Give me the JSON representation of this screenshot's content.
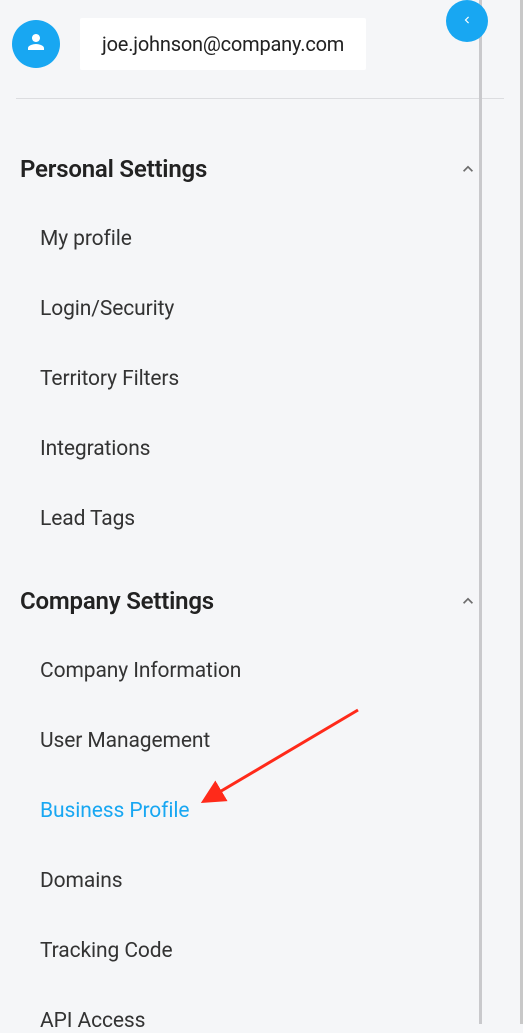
{
  "header": {
    "email": "joe.johnson@company.com"
  },
  "sections": {
    "personal": {
      "title": "Personal Settings",
      "items": [
        {
          "label": "My profile"
        },
        {
          "label": "Login/Security"
        },
        {
          "label": "Territory Filters"
        },
        {
          "label": "Integrations"
        },
        {
          "label": "Lead Tags"
        }
      ]
    },
    "company": {
      "title": "Company Settings",
      "items": [
        {
          "label": "Company Information"
        },
        {
          "label": "User Management"
        },
        {
          "label": "Business Profile"
        },
        {
          "label": "Domains"
        },
        {
          "label": "Tracking Code"
        },
        {
          "label": "API Access"
        }
      ]
    }
  },
  "colors": {
    "accent": "#18a7f2",
    "annotationArrow": "#ff2a1a"
  }
}
